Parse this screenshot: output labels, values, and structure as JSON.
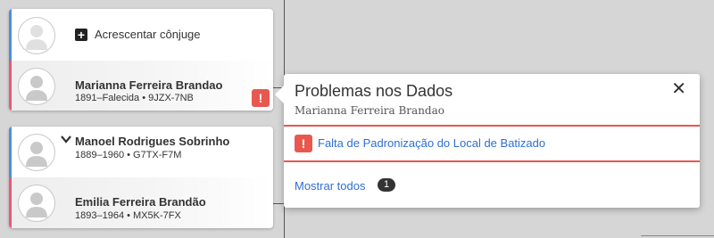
{
  "family_group_1": {
    "add_spouse_label": "Acrescentar cônjuge",
    "person": {
      "name": "Marianna Ferreira Brandao",
      "details": "1891–Falecida • 9JZX-7NB",
      "alert_icon": "exclamation-icon"
    }
  },
  "family_group_2": {
    "father": {
      "name": "Manoel Rodrigues Sobrinho",
      "details": "1889–1960 • G7TX-F7M"
    },
    "mother": {
      "name": "Emilia Ferreira Brandão",
      "details": "1893–1964 • MX5K-7FX"
    }
  },
  "popover": {
    "title": "Problemas nos Dados",
    "subtitle": "Marianna Ferreira Brandao",
    "close_glyph": "✕",
    "issue": {
      "icon": "exclamation-icon",
      "label": "Falta de Padronização do Local de Batizado"
    },
    "show_all_label": "Mostrar todos",
    "count": "1"
  },
  "colors": {
    "male_bar": "#4a90e2",
    "female_bar": "#e8577a",
    "alert": "#e8584f",
    "link": "#2f6fd1"
  }
}
